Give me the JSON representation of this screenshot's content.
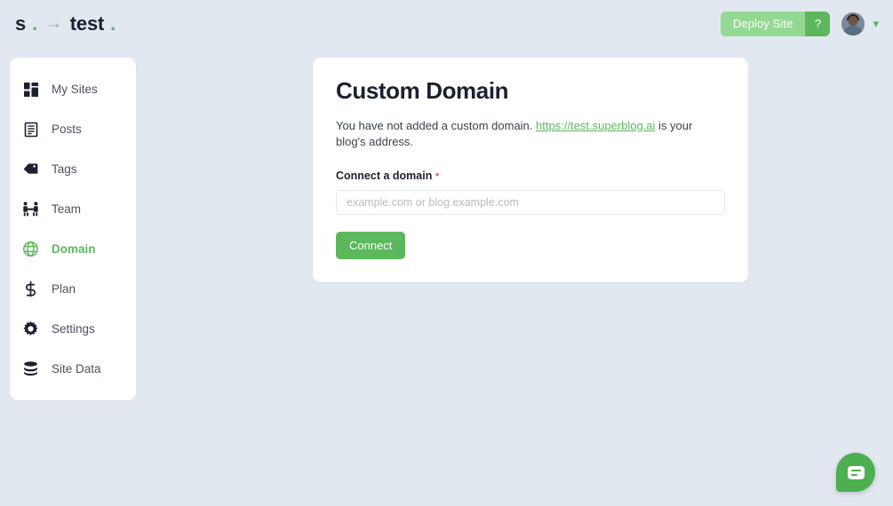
{
  "topbar": {
    "brand": {
      "site_short": "s",
      "dot": ".",
      "arrow_icon": "arrow-right-icon",
      "site_name": "test",
      "name_dot": "."
    },
    "deploy_label": "Deploy Site",
    "help_label": "?",
    "avatar_name": "avatar",
    "chevron_icon": "chevron-down-icon"
  },
  "sidebar": {
    "items": [
      {
        "label": "My Sites",
        "icon": "grid-icon",
        "active": false
      },
      {
        "label": "Posts",
        "icon": "document-icon",
        "active": false
      },
      {
        "label": "Tags",
        "icon": "tag-icon",
        "active": false
      },
      {
        "label": "Team",
        "icon": "team-icon",
        "active": false
      },
      {
        "label": "Domain",
        "icon": "globe-icon",
        "active": true
      },
      {
        "label": "Plan",
        "icon": "dollar-icon",
        "active": false
      },
      {
        "label": "Settings",
        "icon": "gear-icon",
        "active": false
      },
      {
        "label": "Site Data",
        "icon": "database-icon",
        "active": false
      }
    ]
  },
  "card": {
    "title": "Custom Domain",
    "description_before": "You have not added a custom domain. ",
    "blog_url": "https://test.superblog.ai",
    "description_after": " is your blog's address.",
    "field_label": "Connect a domain",
    "required_marker": "*",
    "input_placeholder": "example.com or blog.example.com",
    "input_value": "",
    "connect_label": "Connect"
  },
  "chat": {
    "icon": "chat-bubble-icon"
  },
  "colors": {
    "accent_green": "#5cb85c",
    "deploy_disabled_green": "#93d993",
    "chat_green": "#4caf50",
    "required_red": "#e3566a",
    "page_bg": "#e2e8f0",
    "text_dark": "#1b2130"
  }
}
